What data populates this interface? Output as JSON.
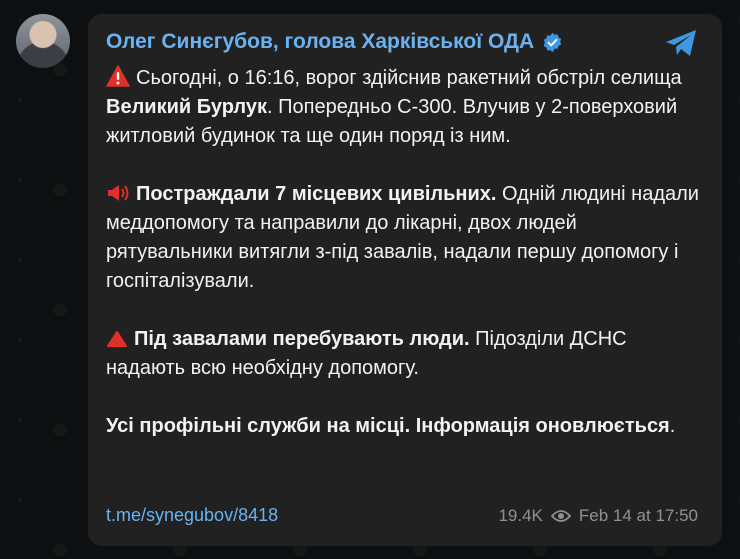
{
  "post": {
    "channel_name": "Олег Синєгубов, голова Харківської ОДА",
    "paragraphs": [
      {
        "parts": [
          {
            "text": "Сьогодні, о 16:16, ворог здійснив ракетний обстріл селища ",
            "bold": false
          },
          {
            "text": "Великий Бурлук",
            "bold": true
          },
          {
            "text": ". Попередньо С-300. Влучив у 2-поверховий житловий будинок та ще один поряд із ним.",
            "bold": false
          }
        ]
      },
      {
        "parts": [
          {
            "text": "Постраждали 7 місцевих цивільних.",
            "bold": true
          },
          {
            "text": " Одній людині надали меддопомогу та направили до лікарні, двох людей рятувальники витягли з-під завалів, надали першу допомогу і госпіталізували.",
            "bold": false
          }
        ]
      },
      {
        "parts": [
          {
            "text": "Під завалами перебувають люди.",
            "bold": true
          },
          {
            "text": " Підозділи ДСНС надають всю необхідну допомогу.",
            "bold": false
          }
        ]
      },
      {
        "parts": [
          {
            "text": "Усі профільні служби на місці. Інформація оновлюється",
            "bold": true
          },
          {
            "text": ".",
            "bold": false
          }
        ]
      }
    ],
    "link": "t.me/synegubov/8418",
    "views": "19.4K",
    "timestamp": "Feb 14 at 17:50"
  },
  "colors": {
    "accent": "#6ab2f2",
    "bubble": "#212121",
    "background": "#0e0f10",
    "alert_red": "#e0302a"
  },
  "icons": [
    "warning-icon",
    "loudspeaker-icon",
    "red-triangle-icon",
    "verified-icon",
    "share-icon",
    "eye-icon"
  ]
}
